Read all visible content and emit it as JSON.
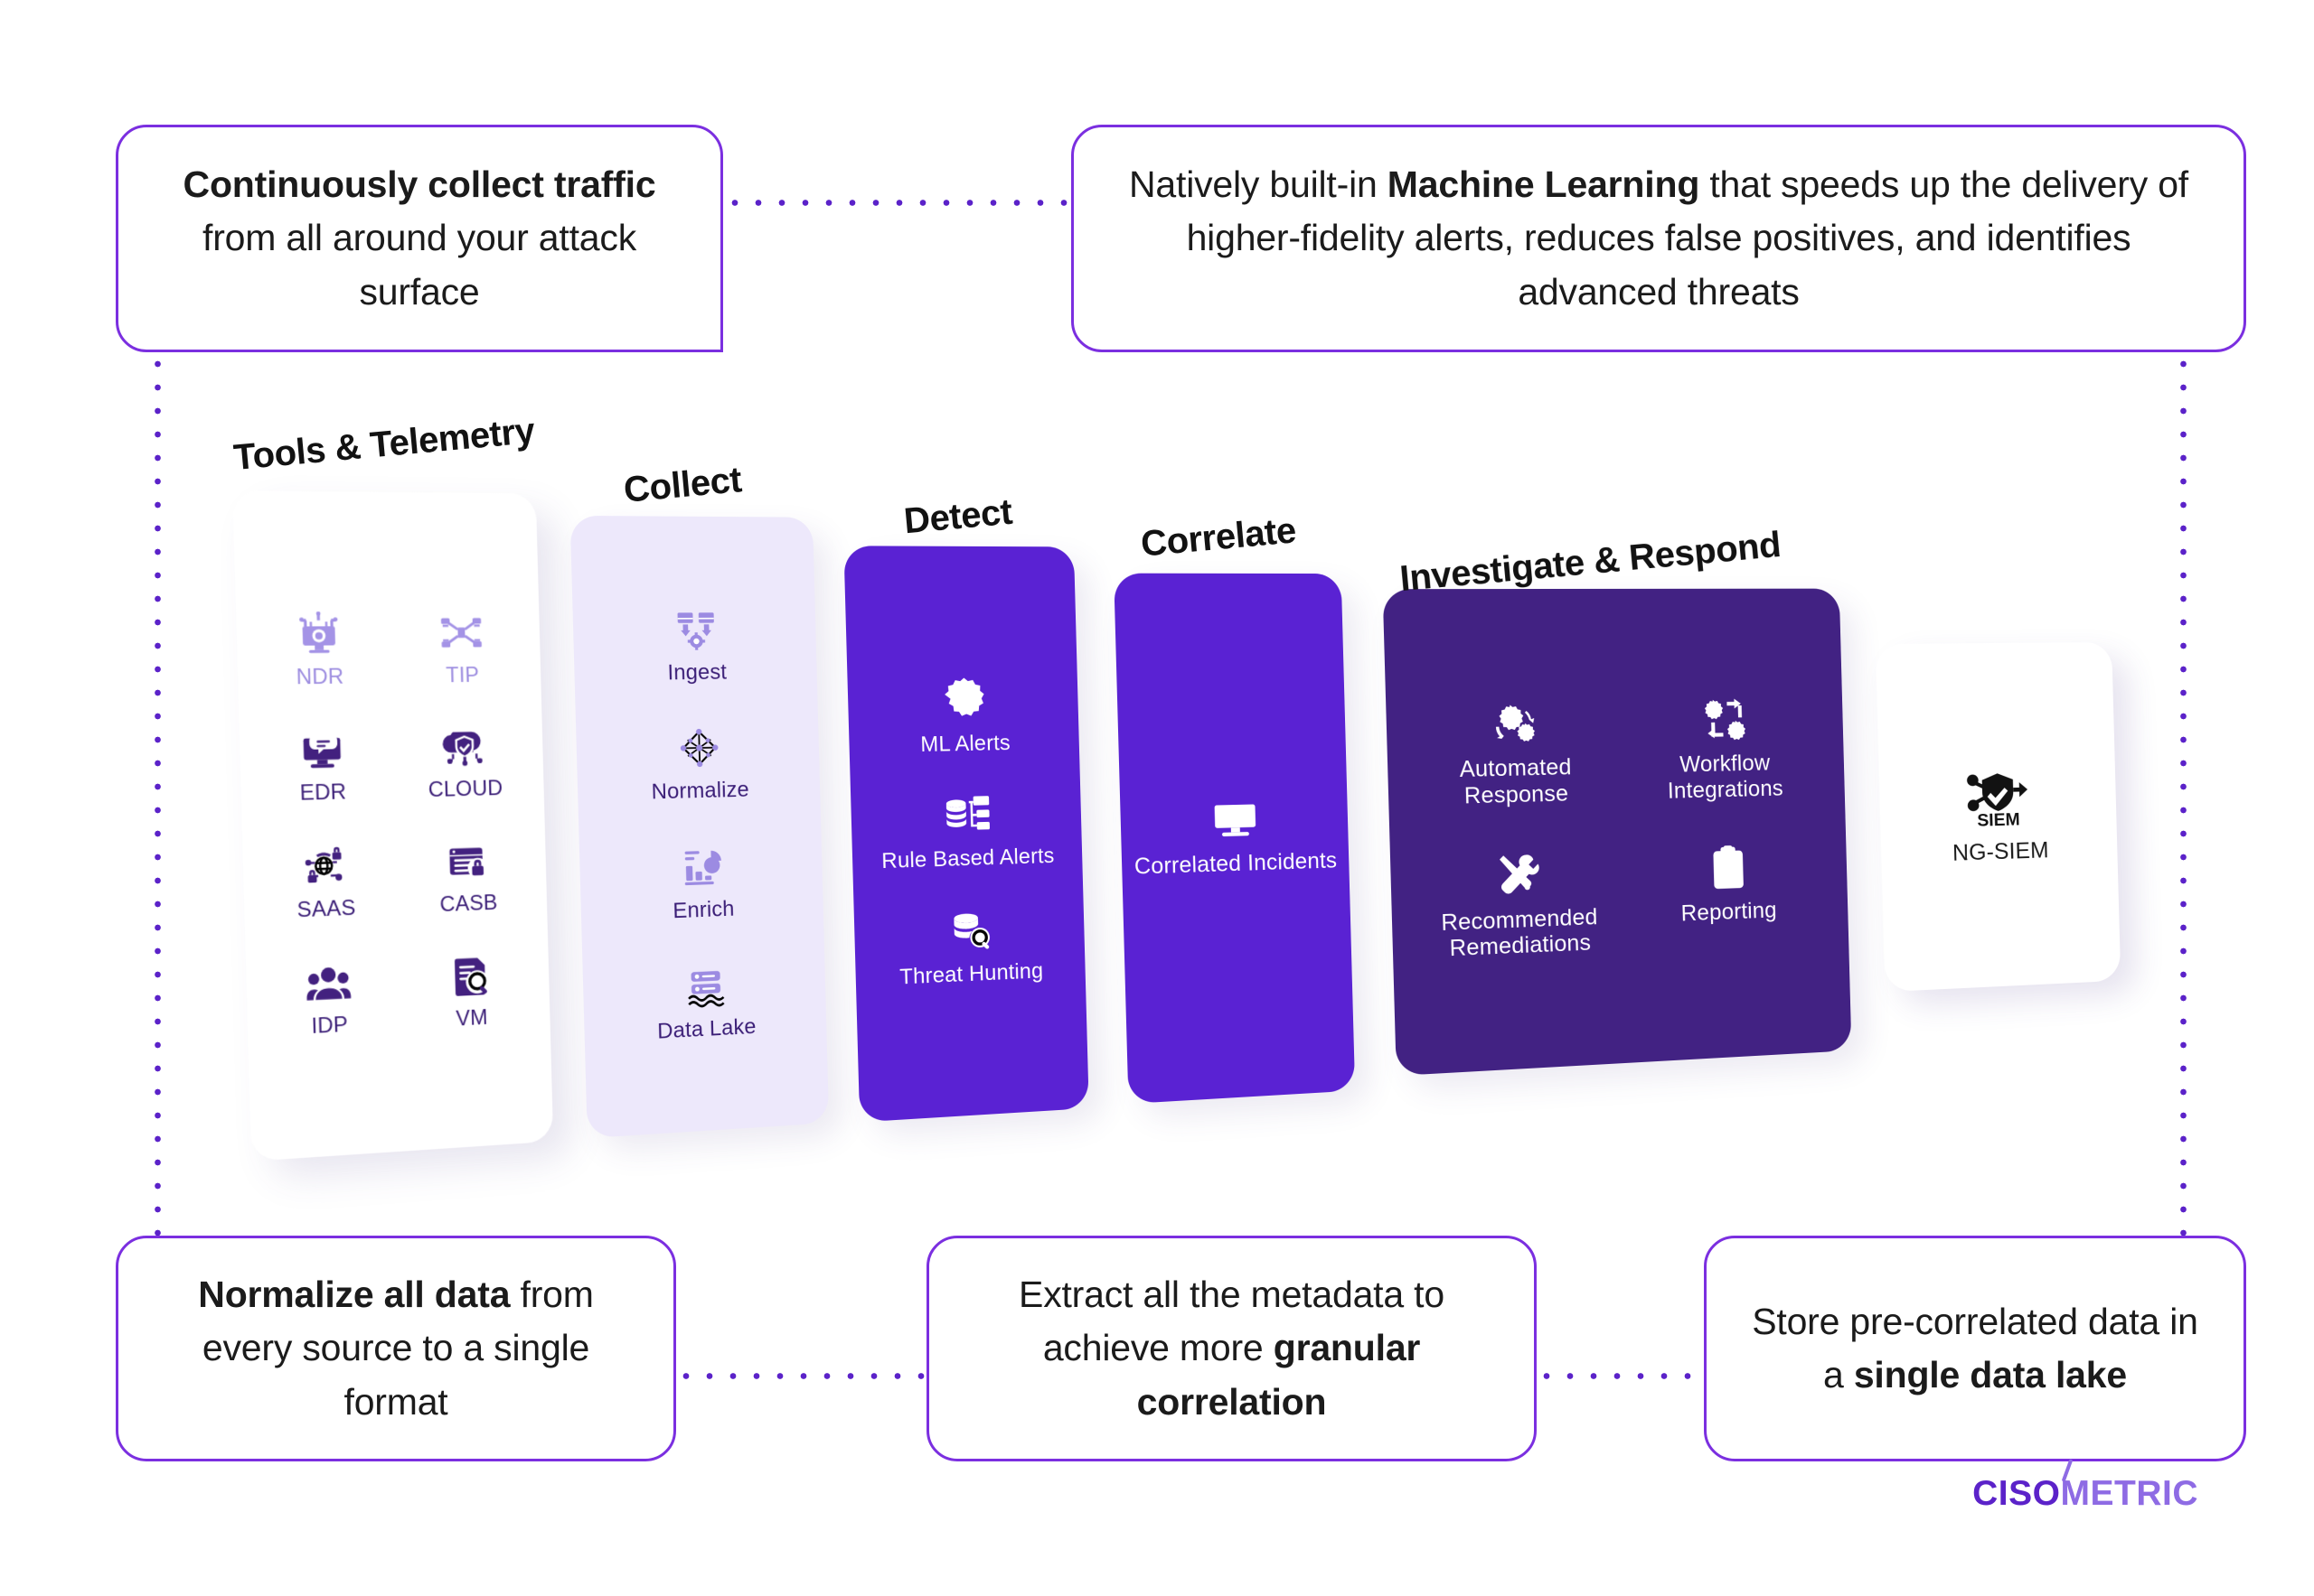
{
  "callouts": {
    "top_left": {
      "bold_1": "Continuously collect traffic",
      "rest_1": " from all around your attack surface"
    },
    "top_right": {
      "pre": "Natively built-in ",
      "bold": "Machine Learning",
      "post": " that speeds up the delivery of higher-fidelity alerts, reduces false positives, and identifies advanced threats"
    },
    "bottom_left": {
      "bold": "Normalize all data",
      "rest": " from every source to a single format"
    },
    "bottom_mid": {
      "pre": "Extract all the metadata to achieve more ",
      "bold": "granular correlation"
    },
    "bottom_right": {
      "pre": "Store pre-correlated data in a ",
      "bold": "single data lake"
    }
  },
  "stages": {
    "tools": {
      "title": "Tools & Telemetry"
    },
    "collect": {
      "title": "Collect"
    },
    "detect": {
      "title": "Detect"
    },
    "correlate": {
      "title": "Correlate"
    },
    "investigate": {
      "title": "Investigate & Respond"
    }
  },
  "tools_items": [
    {
      "label": "NDR",
      "icon": "network-detection-monitor-icon",
      "tone": "light"
    },
    {
      "label": "TIP",
      "icon": "threat-intel-nodes-icon",
      "tone": "light"
    },
    {
      "label": "EDR",
      "icon": "endpoint-monitor-icon",
      "tone": "dark"
    },
    {
      "label": "CLOUD",
      "icon": "cloud-shield-icon",
      "tone": "dark"
    },
    {
      "label": "SAAS",
      "icon": "saas-globe-lock-icon",
      "tone": "dark"
    },
    {
      "label": "CASB",
      "icon": "casb-browser-lock-icon",
      "tone": "dark"
    },
    {
      "label": "IDP",
      "icon": "identity-users-icon",
      "tone": "dark"
    },
    {
      "label": "VM",
      "icon": "vulnerability-scan-icon",
      "tone": "dark"
    }
  ],
  "collect_items": [
    {
      "label": "Ingest",
      "icon": "ingest-gear-icon"
    },
    {
      "label": "Normalize",
      "icon": "normalize-graph-icon"
    },
    {
      "label": "Enrich",
      "icon": "enrich-chart-icon"
    },
    {
      "label": "Data Lake",
      "icon": "data-lake-icon"
    }
  ],
  "detect_items": [
    {
      "label": "ML Alerts",
      "icon": "ml-alert-gear-icon"
    },
    {
      "label": "Rule Based Alerts",
      "icon": "rule-based-database-icon"
    },
    {
      "label": "Threat Hunting",
      "icon": "threat-hunting-search-icon"
    }
  ],
  "correlate_items": [
    {
      "label": "Correlated Incidents",
      "icon": "correlated-incidents-monitor-icon"
    }
  ],
  "investigate_items": [
    {
      "label": "Automated Response",
      "icon": "automated-response-gears-icon"
    },
    {
      "label": "Workflow Integrations",
      "icon": "workflow-integrations-icon"
    },
    {
      "label": "Recommended Remediations",
      "icon": "remediation-tools-icon"
    },
    {
      "label": "Reporting",
      "icon": "reporting-clipboard-icon"
    }
  ],
  "siem_items": [
    {
      "label": "NG-SIEM",
      "icon": "siem-shield-icon"
    }
  ],
  "logo": {
    "part1": "CISO",
    "part2": "METRIC"
  },
  "colors": {
    "accent_purple": "#5B22C9",
    "card_purple": "#5A22D3",
    "card_deep_purple": "#422283",
    "card_lavender": "#EDE8FB",
    "icon_light": "#A493E6",
    "icon_dark": "#43217F",
    "callout_border": "#7B2FE0",
    "logo_dark": "#5B22C9",
    "logo_light": "#8E6BE4"
  }
}
